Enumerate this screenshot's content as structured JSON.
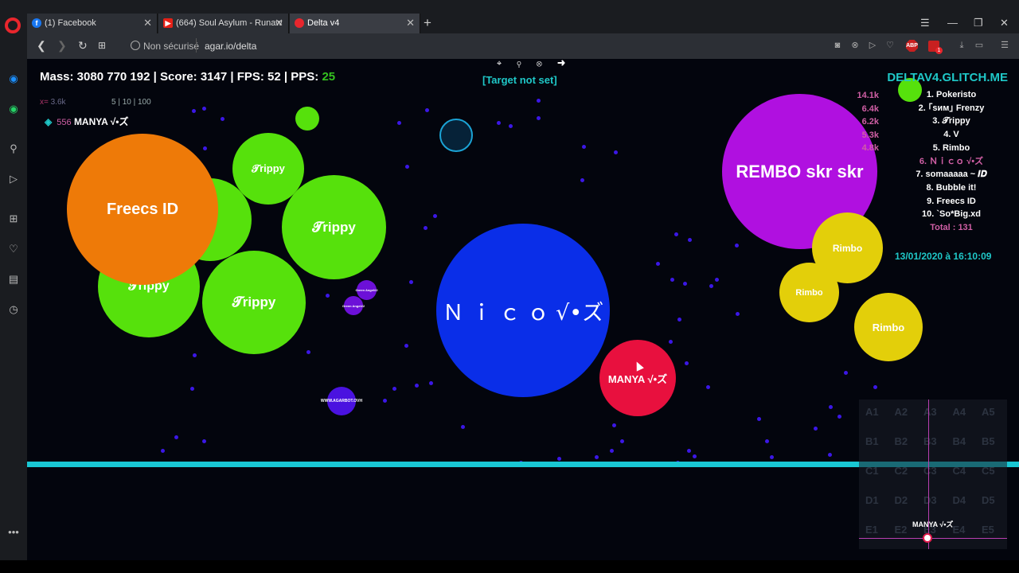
{
  "browser": {
    "tabs": [
      {
        "label": "(1) Facebook",
        "favicon": "facebook-icon"
      },
      {
        "label": "(664) Soul Asylum - Runaw",
        "favicon": "youtube-icon"
      },
      {
        "label": "Delta v4",
        "favicon": "opera-icon"
      }
    ],
    "address": {
      "security": "Non sécurisé",
      "url": "agar.io/delta"
    },
    "abp_badge": "ABP",
    "notif_count": "1"
  },
  "hud": {
    "stats": "Mass: 3080 770 192 | Score: 3147 | FPS: 52 | PPS: ",
    "pps": "25",
    "mini_x": "x=",
    "mini_v": "3.6k",
    "mini_nums": "5 | 10 | 100",
    "player_count": "556",
    "player_name": "MANYA √•ズ"
  },
  "target": {
    "label": "[Target not set]",
    "icons": "⌖ ⚲ ⊗ ➜"
  },
  "server": "DELTAV4.GLITCH.ME",
  "leaderboard": {
    "entries": [
      "1. Pokeristo",
      "2. ｢ѕим｣ Frenzy",
      "3. 𝓣rippy",
      "4. V",
      "5. Rimbo",
      "6. Ｎｉｃｏ √•ズ",
      "7. somaaaaa ~ 𝑰𝑫",
      "8. Bubble it!",
      "9. Freecs ID",
      "10. `So*Big.xd"
    ],
    "total": "Total : 131",
    "masses": [
      "14.1k",
      "6.4k",
      "6.2k",
      "5.3k",
      "4.8k"
    ]
  },
  "datetime": "13/01/2020 à 16:10:09",
  "cells": {
    "freecs": "Freecs  ID",
    "trippy": "𝓣rippy",
    "nico": "Ｎ ｉ ｃ ｏ √•ズ",
    "manya": "MANYA √•ズ",
    "rembo": "REMBO skr skr",
    "rimbo": "Rimbo",
    "bot": "WWW.AGARBOT.OVH",
    "green_angel": "Green Angel#2"
  },
  "minimap": {
    "labels": [
      "A1",
      "A2",
      "A3",
      "A4",
      "A5",
      "B1",
      "B2",
      "B3",
      "B4",
      "B5",
      "C1",
      "C2",
      "C3",
      "C4",
      "C5",
      "D1",
      "D2",
      "D3",
      "D4",
      "D5",
      "E1",
      "E2",
      "E3",
      "E4",
      "E5"
    ],
    "me": "MANYA √•ズ"
  },
  "colors": {
    "freecs": "#ee7a08",
    "trippy": "#56e10c",
    "nico": "#0a2ee8",
    "manya": "#e8103e",
    "rembo": "#b010e0",
    "rimbo": "#e3cf0a",
    "accent": "#1fc8c8"
  }
}
